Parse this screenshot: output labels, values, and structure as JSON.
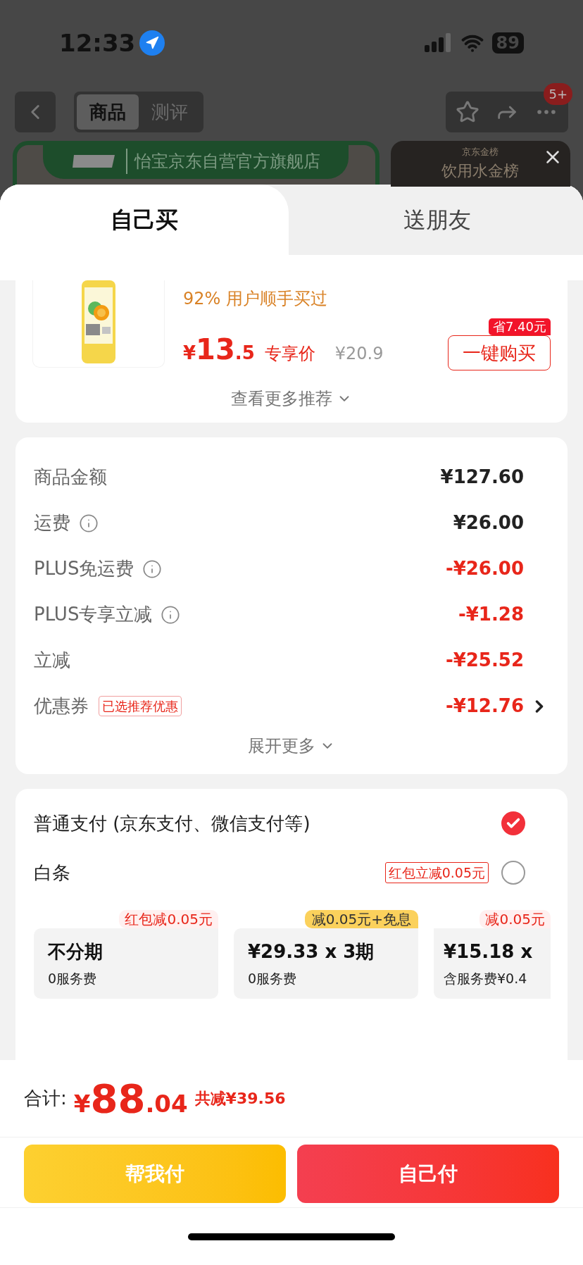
{
  "status_bar": {
    "time": "12:33",
    "battery": "89"
  },
  "nav": {
    "tabs": [
      {
        "label": "商品",
        "selected": true
      },
      {
        "label": "测评",
        "selected": false
      }
    ],
    "badge": "5+"
  },
  "banner": {
    "store": "怡宝京东自营官方旗舰店",
    "ranking_brand": "京东金榜",
    "ranking_title": "饮用水金榜"
  },
  "sheet_tabs": [
    {
      "label": "自己买",
      "selected": true
    },
    {
      "label": "送朋友",
      "selected": false
    }
  ],
  "product": {
    "social_proof": "92% 用户顺手买过",
    "price_symbol": "¥",
    "price_int": "13",
    "price_dec": ".5",
    "price_label": "专享价",
    "original_price": "¥20.9",
    "buy_button": "一键购买",
    "saving_badge": "省7.40元",
    "more": "查看更多推荐"
  },
  "summary": {
    "rows": [
      {
        "label": "商品金额",
        "value": "¥127.60",
        "info": false,
        "discount": false,
        "link": false
      },
      {
        "label": "运费",
        "value": "¥26.00",
        "info": true,
        "discount": false,
        "link": false
      },
      {
        "label": "PLUS免运费",
        "value": "-¥26.00",
        "info": true,
        "discount": true,
        "link": false
      },
      {
        "label": "PLUS专享立减",
        "value": "-¥1.28",
        "info": true,
        "discount": true,
        "link": false
      },
      {
        "label": "立减",
        "value": "-¥25.52",
        "info": false,
        "discount": true,
        "link": false
      },
      {
        "label": "优惠券",
        "tag": "已选推荐优惠",
        "value": "-¥12.76",
        "info": false,
        "discount": true,
        "link": true
      }
    ],
    "expand": "展开更多"
  },
  "payment": {
    "options": [
      {
        "label": "普通支付 (京东支付、微信支付等)",
        "selected": true
      },
      {
        "label": "白条",
        "tag": "红包立减0.05元",
        "selected": false
      }
    ],
    "plans": [
      {
        "tag": "红包减0.05元",
        "kind": "red",
        "title": "不分期",
        "note": "0服务费"
      },
      {
        "tag": "减0.05元+免息",
        "kind": "yellow",
        "title": "¥29.33 x 3期",
        "note": "0服务费"
      },
      {
        "tag": "减0.05元",
        "kind": "red",
        "title": "¥15.18 x",
        "note": "含服务费¥0.4"
      }
    ]
  },
  "footer": {
    "total_label": "合计:",
    "symbol": "¥",
    "int": "88",
    "dec": ".04",
    "saved": "共减¥39.56",
    "buttons": [
      {
        "label": "帮我付",
        "kind": "friend"
      },
      {
        "label": "自己付",
        "kind": "self"
      }
    ]
  }
}
